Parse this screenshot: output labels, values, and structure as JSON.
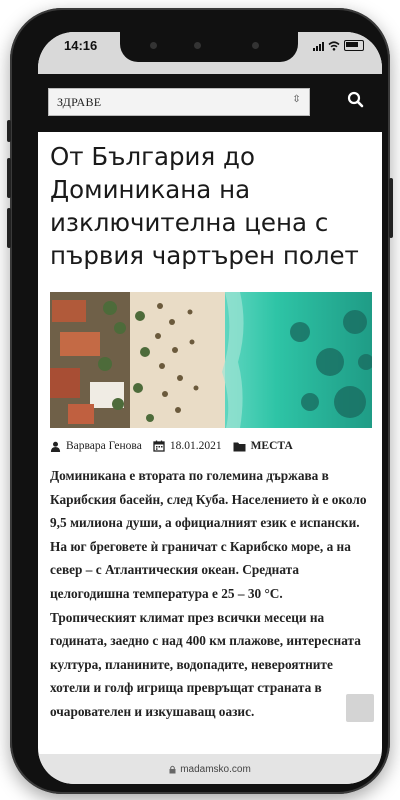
{
  "status_bar": {
    "time": "14:16"
  },
  "header": {
    "category_select": {
      "selected": "ЗДРАВЕ"
    },
    "search_icon": "search-icon"
  },
  "article": {
    "title": "От България до Доминикана на изключителна цена с първия чартърен полет",
    "hero_image": "aerial-beach-image",
    "meta": {
      "author": "Варвара Генова",
      "date": "18.01.2021",
      "category": "МЕСТА"
    },
    "body": "Доминикана е втората по големина държава в Карибския басейн, след Куба. Населението ѝ е около 9,5 милиона души, а официалният език е испански. На юг бреговете ѝ граничат с Карибско море, а на север – с Атлантическия океан. Средната целогодишна температура е 25 – 30 °С.  Тропическият климат през всички месеци на годината, заедно с над 400 км плажове, интересната култура, планините, водопадите, невероятните хотели и голф игрища превръщат страната в очарователен и изкушаващ оазис."
  },
  "browser": {
    "url": "madamsko.com"
  },
  "colors": {
    "header_bg": "#111111",
    "ocean": "#2ec4a6",
    "sand": "#e9dcc6"
  }
}
